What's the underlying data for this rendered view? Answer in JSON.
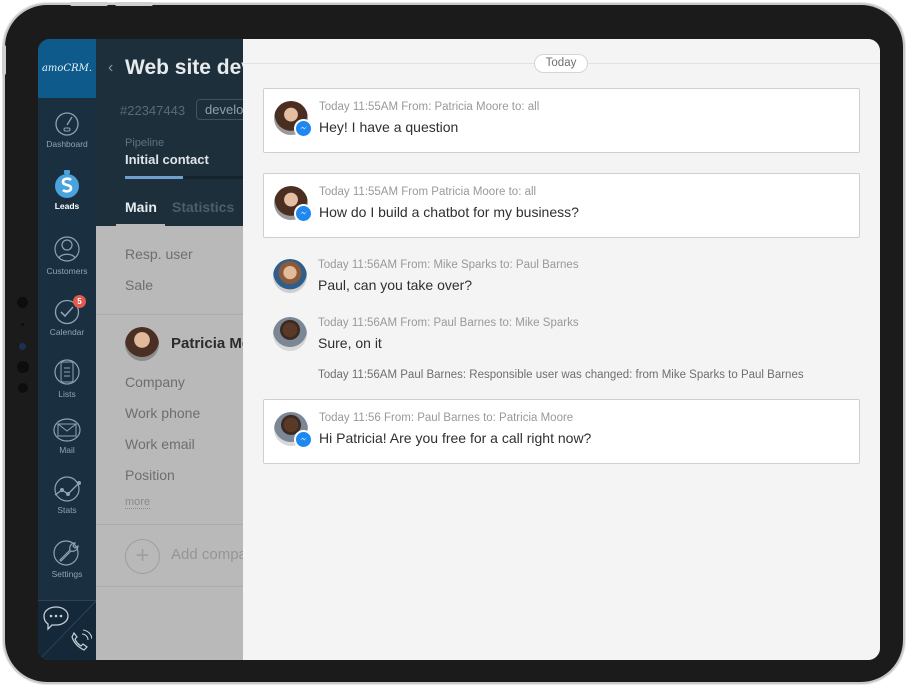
{
  "app": {
    "logo": "amoCRM."
  },
  "sidebar": {
    "items": [
      {
        "label": "Dashboard",
        "icon": "speedometer-icon"
      },
      {
        "label": "Leads",
        "icon": "dollar-bag-icon",
        "active": true
      },
      {
        "label": "Customers",
        "icon": "customers-icon"
      },
      {
        "label": "Calendar",
        "icon": "checkmark-icon",
        "badge": "5"
      },
      {
        "label": "Lists",
        "icon": "list-icon"
      },
      {
        "label": "Mail",
        "icon": "envelope-icon"
      },
      {
        "label": "Stats",
        "icon": "chart-icon"
      },
      {
        "label": "Settings",
        "icon": "wrench-icon"
      }
    ],
    "bottom": {
      "chat_icon": "chat-icon",
      "phone_icon": "phone-icon"
    }
  },
  "lead": {
    "title": "Web site development",
    "id": "#22347443",
    "tag": "development",
    "pipeline_label": "Pipeline",
    "pipeline_value": "Initial contact",
    "pipeline_progress": 0.29,
    "tabs": [
      {
        "label": "Main"
      },
      {
        "label": "Statistics"
      }
    ],
    "fields": [
      "Resp. user",
      "Sale"
    ],
    "contact": {
      "name": "Patricia Moore",
      "fields": [
        "Company",
        "Work phone",
        "Work email",
        "Position"
      ],
      "more": "more"
    },
    "add_company": "Add company"
  },
  "feed": {
    "date": "Today",
    "messages": [
      {
        "meta": "Today 11:55AM From: Patricia Moore to: all",
        "text": "Hey! I have a question",
        "author": "patricia",
        "channel": "messenger",
        "card": true
      },
      {
        "meta": "Today 11:55AM From Patricia Moore to: all",
        "text": "How do I build a chatbot for my business?",
        "author": "patricia",
        "channel": "messenger",
        "card": true
      },
      {
        "meta": "Today 11:56AM From: Mike Sparks to: Paul Barnes",
        "text": "Paul, can you take over?",
        "author": "mike",
        "card": false
      },
      {
        "meta": "Today 11:56AM From: Paul Barnes to: Mike Sparks",
        "text": "Sure, on it",
        "author": "paul",
        "card": false
      },
      {
        "meta": "Today 11:56 From: Paul Barnes to: Patricia Moore",
        "text": "Hi Patricia! Are you free for a call right now?",
        "author": "paul",
        "channel": "messenger",
        "card": true
      }
    ],
    "system_event": "Today 11:56AM Paul Barnes: Responsible user was changed: from Mike Sparks to Paul Barnes"
  },
  "colors": {
    "sidebar": "#1a3040",
    "logo_bg": "#0e5a8a",
    "badge": "#e05a4f",
    "messenger": "#1e88f0",
    "progress": "#6f9fcf"
  }
}
